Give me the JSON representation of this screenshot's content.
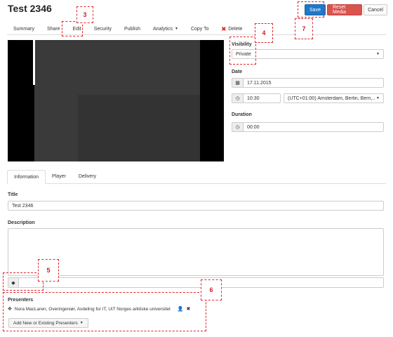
{
  "page": {
    "title": "Test 2346"
  },
  "actions": {
    "save": "Save",
    "reset": "Reset Media",
    "cancel": "Cancel"
  },
  "nav_tabs": [
    {
      "label": "Summary"
    },
    {
      "label": "Share"
    },
    {
      "label": "Edit"
    },
    {
      "label": "Security"
    },
    {
      "label": "Publish"
    },
    {
      "label": "Analytics"
    },
    {
      "label": "Copy To"
    },
    {
      "label": "Delete"
    }
  ],
  "settings": {
    "visibility_label": "Visibility",
    "visibility_value": "Private",
    "date_label": "Date",
    "date_value": "17.11.2015",
    "time_value": "10:30",
    "timezone_value": "(UTC+01:00) Amsterdam, Berlin, Bern,...",
    "duration_label": "Duration",
    "duration_value": "00:00"
  },
  "sub_tabs": [
    {
      "label": "Information"
    },
    {
      "label": "Player"
    },
    {
      "label": "Delivery"
    }
  ],
  "info": {
    "title_label": "Title",
    "title_value": "Test 2346",
    "description_label": "Description",
    "description_value": ""
  },
  "presenters": {
    "label": "Presenters",
    "items": [
      {
        "name": "Nora MacLaren, Overingeniør, Avdeling for IT, UiT Norges arktiske universitet"
      }
    ],
    "add_button": "Add New or Existing Presenters"
  },
  "annotations": [
    {
      "number": "3"
    },
    {
      "number": "4"
    },
    {
      "number": "7"
    },
    {
      "number": "5"
    },
    {
      "number": "6"
    }
  ],
  "colors": {
    "save": "#1f78c8",
    "reset": "#d9534f",
    "annotation": "#e0282e",
    "delete": "#dd3333"
  }
}
